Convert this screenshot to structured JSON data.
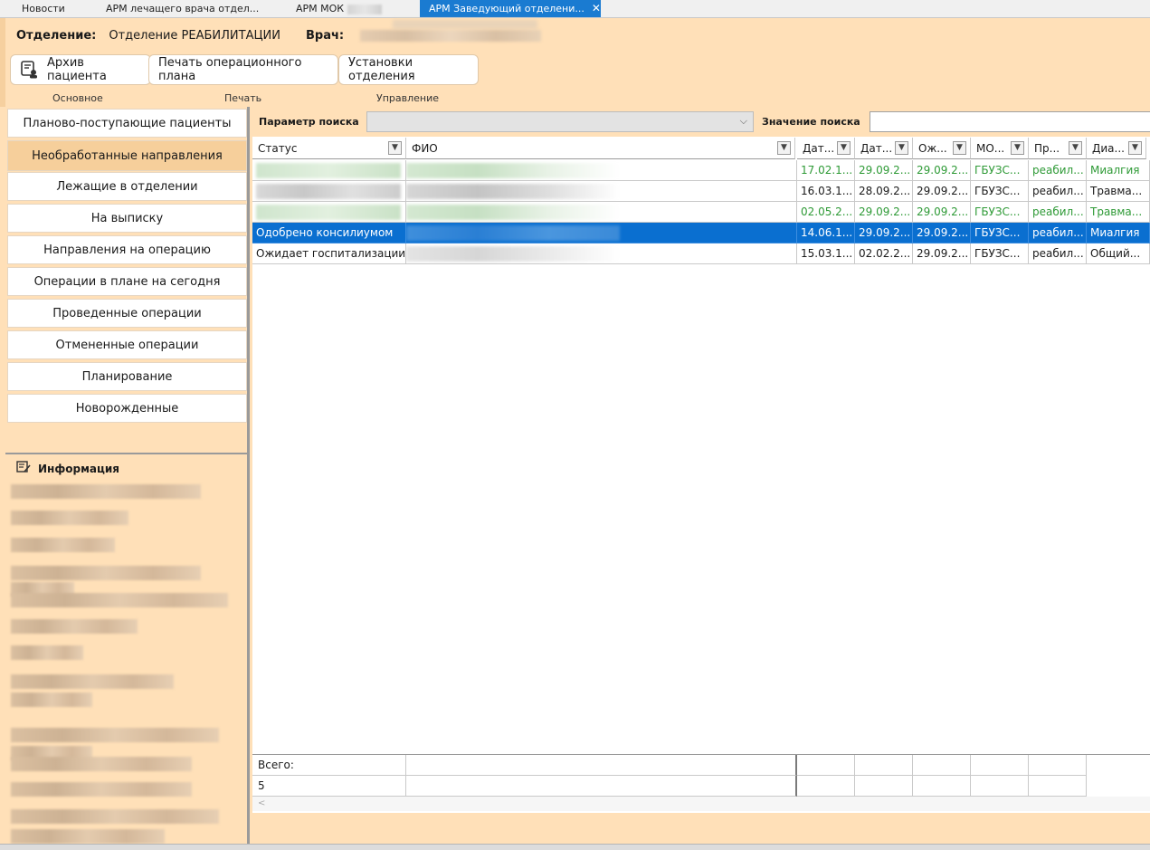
{
  "tabs": [
    {
      "label": "Новости",
      "active": false
    },
    {
      "label": "АРМ лечащего врача отдел...",
      "active": false
    },
    {
      "label": "АРМ МОК",
      "active": false
    },
    {
      "label": "АРМ Заведующий отделени...",
      "active": true
    }
  ],
  "header": {
    "department_label": "Отделение:",
    "department_value": "Отделение РЕАБИЛИТАЦИИ",
    "doctor_label": "Врач:"
  },
  "ribbon": {
    "buttons": {
      "archive": "Архив пациента",
      "print_plan": "Печать операционного плана",
      "dept_settings": "Установки отделения"
    },
    "groups": {
      "main": "Основное",
      "print": "Печать",
      "manage": "Управление"
    }
  },
  "nav": [
    {
      "label": "Планово-поступающие пациенты",
      "active": false
    },
    {
      "label": "Необработанные направления",
      "active": true
    },
    {
      "label": "Лежащие в отделении",
      "active": false
    },
    {
      "label": "На выписку",
      "active": false
    },
    {
      "label": "Направления на операцию",
      "active": false
    },
    {
      "label": "Операции в плане на сегодня",
      "active": false
    },
    {
      "label": "Проведенные операции",
      "active": false
    },
    {
      "label": "Отмененные операции",
      "active": false
    },
    {
      "label": "Планирование",
      "active": false
    },
    {
      "label": "Новорожденные",
      "active": false
    }
  ],
  "info": {
    "title": "Информация"
  },
  "search": {
    "param_label": "Параметр поиска",
    "value_label": "Значение поиска",
    "param_value": "",
    "value_text": ""
  },
  "grid": {
    "columns": [
      "Статус",
      "ФИО",
      "Дат...",
      "Дат...",
      "Ож...",
      "МО...",
      "Пр...",
      "Диа..."
    ],
    "rows": [
      {
        "status": "",
        "fio": "",
        "d1": "17.02.1...",
        "d2": "29.09.2...",
        "wait": "29.09.2...",
        "mo": "ГБУЗС...",
        "pr": "реабил...",
        "diag": "Миалгия",
        "style": "green"
      },
      {
        "status": "",
        "fio": "",
        "d1": "16.03.1...",
        "d2": "28.09.2...",
        "wait": "29.09.2...",
        "mo": "ГБУЗС...",
        "pr": "реабил...",
        "diag": "Травма...",
        "style": "normal"
      },
      {
        "status": "",
        "fio": "",
        "d1": "02.05.2...",
        "d2": "29.09.2...",
        "wait": "29.09.2...",
        "mo": "ГБУЗС...",
        "pr": "реабил...",
        "diag": "Травма...",
        "style": "green"
      },
      {
        "status": "Одобрено консилиумом",
        "fio": "",
        "d1": "14.06.1...",
        "d2": "29.09.2...",
        "wait": "29.09.2...",
        "mo": "ГБУЗС...",
        "pr": "реабил...",
        "diag": "Миалгия",
        "style": "selected"
      },
      {
        "status": "Ожидает госпитализации",
        "fio": "",
        "d1": "15.03.1...",
        "d2": "02.02.2...",
        "wait": "29.09.2...",
        "mo": "ГБУЗС...",
        "pr": "реабил...",
        "diag": "Общий...",
        "style": "normal"
      }
    ],
    "footer": {
      "total_label": "Всего:",
      "total_value": "5"
    },
    "scroll_left": "<"
  },
  "colors": {
    "accent": "#1a7bd1",
    "panel": "#ffe0b8",
    "selected_row": "#0a6fd0",
    "green_text": "#2e9a36"
  },
  "icons": [
    "close-icon",
    "patient-archive-icon",
    "info-icon",
    "dropdown-arrow-icon",
    "chevron-down-icon"
  ]
}
